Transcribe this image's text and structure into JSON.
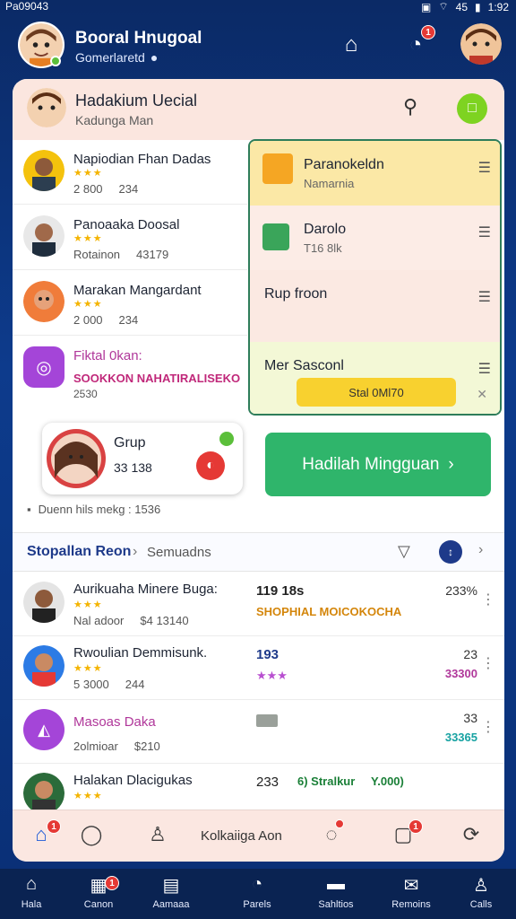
{
  "status": {
    "left": "Pa09043",
    "right": "45",
    "time": "1:92"
  },
  "header": {
    "title": "Booral Hnugoal",
    "subtitle": "Gomerlaretd"
  },
  "card_header": {
    "title": "Hadakium Uecial",
    "subtitle": "Kadunga Man"
  },
  "users": [
    {
      "name": "Napiodian Fhan Dadas",
      "meta1": "2 800",
      "meta2": "234"
    },
    {
      "name": "Panoaaka Doosal",
      "meta1": "Rotainon",
      "meta2": "43179"
    },
    {
      "name": "Marakan Mangardant",
      "meta1": "2 000",
      "meta2": "234"
    },
    {
      "name": "Fiktal 0kan:",
      "sub": "SOOKKON NAHATIRALISEKO",
      "meta1": "2530"
    }
  ],
  "side_panel": [
    {
      "title": "Paranokeldn",
      "sub": "Namarnia"
    },
    {
      "title": "Darolo",
      "sub": "T16 8lk"
    },
    {
      "title": "Rup froon"
    },
    {
      "title": "Mer Sasconl",
      "button": "Stal 0Ml70"
    }
  ],
  "group": {
    "title": "Grup",
    "count": "33 138"
  },
  "weekly_button": "Hadilah Mingguan",
  "note": "Duenn hils mekg : 1536",
  "tabs": {
    "active": "Stopallan Reon",
    "other": "Semuadns"
  },
  "list": [
    {
      "name": "Aurikuaha Minere Buga:",
      "meta1": "Nal adoor",
      "meta2": "$4 13140",
      "v1": "119 18s",
      "v2": "SHOPHIAL MOICOKOCHA",
      "pct": "233%"
    },
    {
      "name": "Rwoulian Demmisunk.",
      "meta1": "5 3000",
      "meta2": "244",
      "v1": "193",
      "v2": "",
      "pct": "23",
      "pct2": "33300"
    },
    {
      "name": "Masoas Daka",
      "meta1": "2olmioar",
      "meta2": "$210",
      "v1": "",
      "v2": "",
      "pct": "33",
      "pct2": "33365"
    },
    {
      "name": "Halakan Dlacigukas",
      "meta1": "",
      "meta2": "",
      "v1": "233",
      "v2": "6) Stralkur",
      "v3": "Y.000)",
      "pct": ""
    }
  ],
  "card_nav": {
    "center": "Kolkaiiga Aon"
  },
  "bottom_nav": [
    "Hala",
    "Canon",
    "Aamaaa",
    "Parels",
    "Sahltios",
    "Remoins",
    "Calls"
  ],
  "colors": {
    "accent_green": "#2fb56b",
    "header_blue": "#0d3b8c",
    "badge_red": "#e53935",
    "star": "#f4b400"
  }
}
